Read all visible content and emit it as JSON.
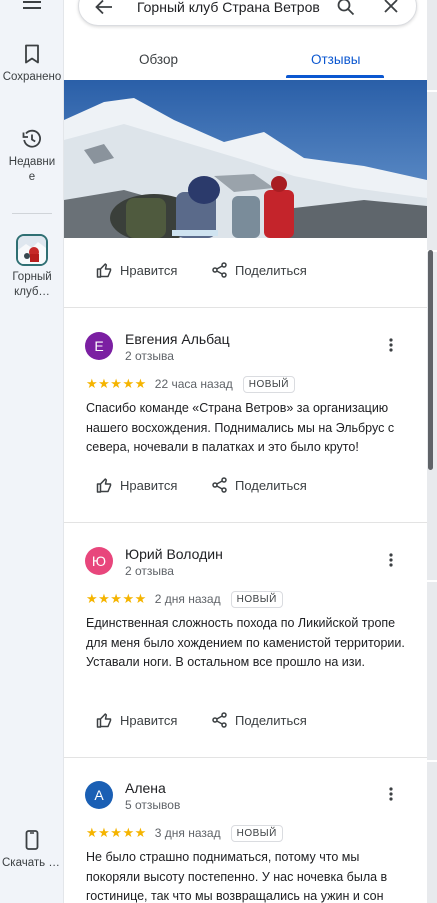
{
  "rail": {
    "saved_label": "Сохранено",
    "recent_label": "Недавние",
    "place_label": "Горный клуб…",
    "download_label": "Скачать приложение"
  },
  "search": {
    "query": "Горный клуб Страна Ветров"
  },
  "tabs": [
    {
      "label": "Обзор",
      "active": false
    },
    {
      "label": "Отзывы",
      "active": true
    }
  ],
  "actions": {
    "like_label": "Нравится",
    "share_label": "Поделиться"
  },
  "reviews": [
    {
      "avatar_letter": "Е",
      "avatar_color": "#7b1fa2",
      "name": "Евгения Альбац",
      "count": "2 отзыва",
      "stars": "★★★★★",
      "date": "22 часа назад",
      "badge": "НОВЫЙ",
      "text": "Спасибо команде «Страна Ветров» за организацию нашего восхождения. Поднимались мы на Эльбрус с севера, ночевали в палатках и это было круто!"
    },
    {
      "avatar_letter": "Ю",
      "avatar_color": "#e8467c",
      "name": "Юрий Володин",
      "count": "2 отзыва",
      "stars": "★★★★★",
      "date": "2 дня назад",
      "badge": "НОВЫЙ",
      "text": "Единственная сложность похода по Ликийской тропе для меня было хождением по каменистой территории. Уставали ноги. В остальном все прошло на изи."
    },
    {
      "avatar_letter": "А",
      "avatar_color": "#1a5fb4",
      "name": "Алена",
      "count": "5 отзывов",
      "stars": "★★★★★",
      "date": "3 дня назад",
      "badge": "НОВЫЙ",
      "text": "Не было страшно подниматься, потому что мы покоряли высоту постепенно. У нас ночевка была в гостинице, так что мы возвращались на ужин и сон"
    }
  ],
  "colors": {
    "accent": "#0b57d0",
    "star": "#f5b400"
  }
}
